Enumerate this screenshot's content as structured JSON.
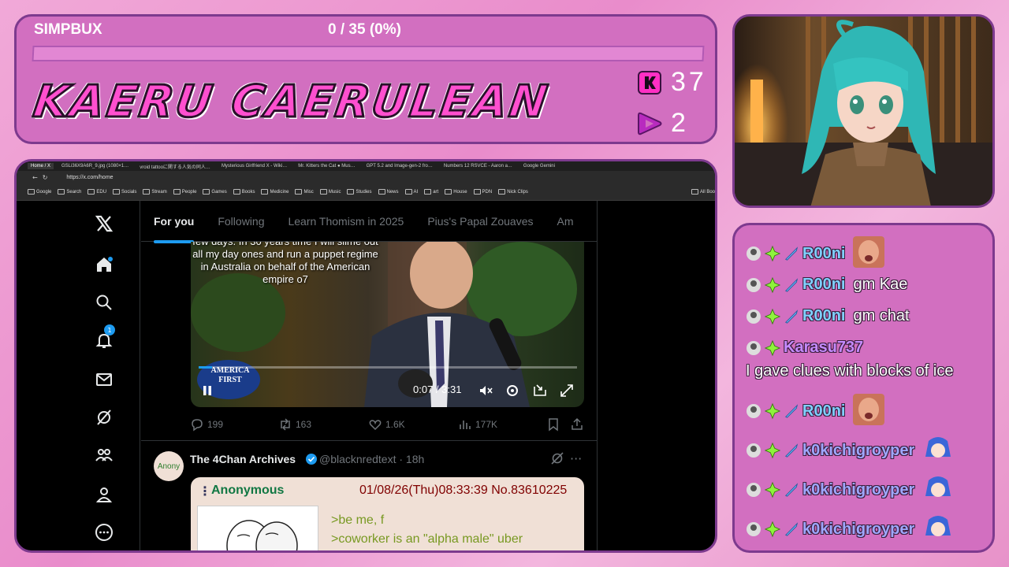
{
  "header": {
    "simpbux_label": "SIMPBUX",
    "simpbux_value": "0 / 35 (0%)",
    "simpbux_progress": 0,
    "streamer_name": "KAERU CAERULEAN",
    "kick_count": "37",
    "rumble_count": "2",
    "colors": {
      "accent": "#ff4fcf",
      "panel": "#d26fc0",
      "border": "#7d3a8e"
    }
  },
  "browser": {
    "tabs": [
      "Home / X",
      "GSLi36X9A6R_9.jpg (1080×1…",
      "vroid tattooに関する人気の同人…",
      "Mysterious Girlfriend X - Wiki…",
      "Mr. Kitters the Cat ● Mus…",
      "GPT 5.2 and Image-gen-2 fro…",
      "Numbers 12 RSVCE - Aaron a…",
      "Google Gemini"
    ],
    "url": "https://x.com/home",
    "bookmarks": [
      "Google",
      "Search",
      "EDU",
      "Socials",
      "Stream",
      "People",
      "Games",
      "Books",
      "Medicine",
      "Misc",
      "Music",
      "Studies",
      "News",
      "AI",
      "art",
      "House",
      "PDN",
      "Nick Clips",
      "All Boo"
    ]
  },
  "x": {
    "nav_icons": [
      "x-logo-icon",
      "home-icon",
      "search-icon",
      "notifications-icon",
      "messages-icon",
      "grok-icon",
      "communities-icon",
      "profile-icon",
      "more-icon"
    ],
    "notification_count": "1",
    "feed_tabs": [
      "For you",
      "Following",
      "Learn Thomism in 2025",
      "Pius's Papal Zouaves",
      "Am"
    ],
    "video": {
      "caption": "few days. In 30 years time I will slime out all my day ones and run a puppet regime in Australia on behalf of the American empire o7",
      "hat_text": "AMERICA FIRST",
      "time": "0:07 / 3:31",
      "progress": 0.035
    },
    "actions": {
      "replies": "199",
      "reposts": "163",
      "likes": "1.6K",
      "views": "177K"
    },
    "post2": {
      "avatar_text": "Anony",
      "name": "The 4Chan Archives",
      "handle": "@blacknredtext · 18h",
      "card": {
        "poster": "Anonymous",
        "meta": "01/08/26(Thu)08:33:39 No.83610225",
        "lines": [
          ">be me, f",
          ">coworker is an \"alpha male\" uber"
        ]
      }
    }
  },
  "chat": [
    {
      "user": "R00ni",
      "color": "#7fd0ff",
      "text": "",
      "emote": "face-emote",
      "badges": [
        "avatar",
        "sub-gem",
        "sword"
      ]
    },
    {
      "user": "R00ni",
      "color": "#7fd0ff",
      "text": "gm Kae",
      "badges": [
        "avatar",
        "sub-gem",
        "sword"
      ]
    },
    {
      "user": "R00ni",
      "color": "#7fd0ff",
      "text": "gm chat",
      "badges": [
        "avatar",
        "sub-gem",
        "sword"
      ]
    },
    {
      "user": "Karasu737",
      "color": "#c58bff",
      "text": "I gave clues with blocks of ice",
      "badges": [
        "avatar",
        "sub-gem"
      ]
    },
    {
      "user": "R00ni",
      "color": "#7fd0ff",
      "text": "",
      "emote": "face-emote",
      "badges": [
        "avatar",
        "sub-gem",
        "sword"
      ]
    },
    {
      "user": "k0kichigroyper",
      "color": "#9fa8ff",
      "text": "",
      "emote": "chibi-emote",
      "badges": [
        "avatar",
        "sub-gem",
        "sword"
      ]
    },
    {
      "user": "k0kichigroyper",
      "color": "#9fa8ff",
      "text": "",
      "emote": "chibi-emote",
      "badges": [
        "avatar",
        "sub-gem",
        "sword"
      ]
    },
    {
      "user": "k0kichigroyper",
      "color": "#9fa8ff",
      "text": "",
      "emote": "chibi-emote",
      "badges": [
        "avatar",
        "sub-gem",
        "sword"
      ]
    }
  ]
}
